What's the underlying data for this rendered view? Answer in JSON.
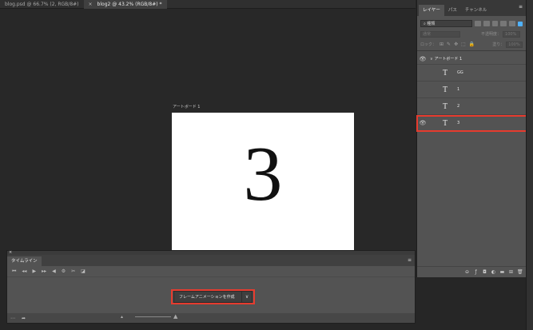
{
  "doc_tabs": [
    {
      "label": "blog.psd @ 66.7% (2, RGB/8#)",
      "active": false
    },
    {
      "label": "blog2 @ 43.2% (RGB/8#) *",
      "active": true,
      "close": "×"
    }
  ],
  "canvas": {
    "artboard_label": "アートボード 1",
    "big_text": "3"
  },
  "layers_panel": {
    "tabs": [
      "レイヤー",
      "パス",
      "チャンネル"
    ],
    "menu": "≡",
    "kind_filter": "種類",
    "blend_mode": "通常",
    "opacity_label": "不透明度：",
    "opacity_value": "100%",
    "lock_label": "ロック：",
    "fill_label": "塗り：",
    "fill_value": "100%",
    "group_name": "アートボード 1",
    "layers": [
      {
        "name": "GG",
        "visible": false
      },
      {
        "name": "1",
        "visible": false
      },
      {
        "name": "2",
        "visible": false
      },
      {
        "name": "3",
        "visible": true
      }
    ],
    "thumb_glyph": "T",
    "eye_glyph": "👁"
  },
  "timeline": {
    "tab": "タイムライン",
    "close": "×",
    "menu": "≡",
    "create_button": "フレームアニメーションを作成",
    "dropdown": "∨"
  },
  "colors": {
    "highlight": "#e63b2e",
    "panel_bg": "#535353",
    "canvas_bg": "#282828"
  }
}
